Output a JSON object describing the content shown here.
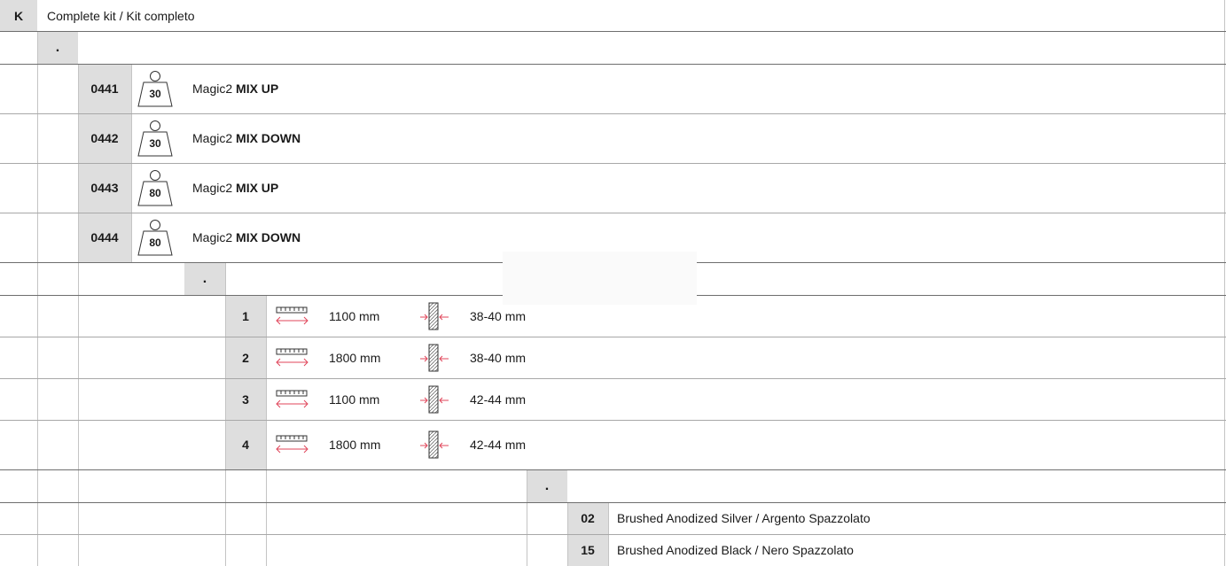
{
  "header": {
    "code": "K",
    "title": "Complete kit / Kit completo"
  },
  "section_marker": ".",
  "models": [
    {
      "code": "0441",
      "weight": "30",
      "name": "Magic2",
      "variant": "MIX UP"
    },
    {
      "code": "0442",
      "weight": "30",
      "name": "Magic2",
      "variant": "MIX DOWN"
    },
    {
      "code": "0443",
      "weight": "80",
      "name": "Magic2",
      "variant": "MIX UP"
    },
    {
      "code": "0444",
      "weight": "80",
      "name": "Magic2",
      "variant": "MIX DOWN"
    }
  ],
  "sizes": [
    {
      "code": "1",
      "length": "1100 mm",
      "thickness": "38-40 mm"
    },
    {
      "code": "2",
      "length": "1800 mm",
      "thickness": "38-40 mm"
    },
    {
      "code": "3",
      "length": "1100 mm",
      "thickness": "42-44 mm"
    },
    {
      "code": "4",
      "length": "1800 mm",
      "thickness": "42-44 mm"
    }
  ],
  "finishes": [
    {
      "code": "02",
      "label": "Brushed Anodized Silver / Argento Spazzolato"
    },
    {
      "code": "15",
      "label": "Brushed Anodized Black / Nero Spazzolato"
    }
  ],
  "icons": {
    "weight": "weight-icon",
    "length": "length-ruler-icon",
    "thickness": "door-thickness-icon"
  },
  "colors": {
    "cell_grey": "#dedede",
    "arrow_red": "#e0455a"
  }
}
